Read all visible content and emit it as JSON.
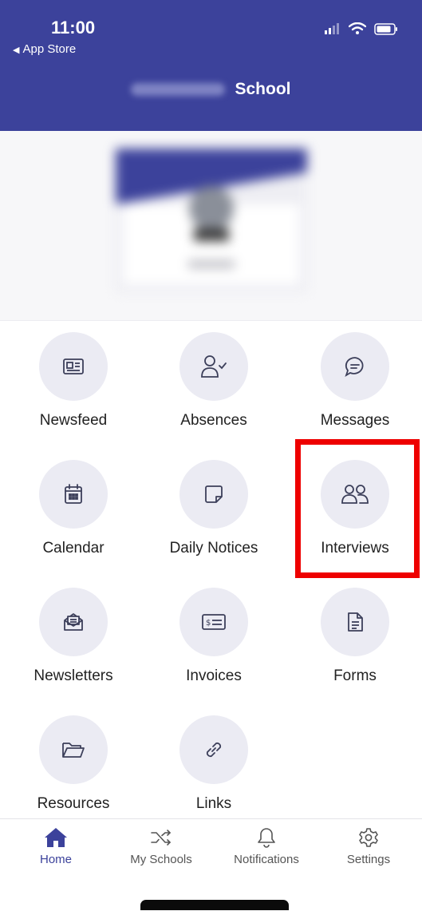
{
  "status_bar": {
    "time": "11:00",
    "back_label": "App Store"
  },
  "header": {
    "title": "School"
  },
  "grid": {
    "items": [
      {
        "label": "Newsfeed",
        "icon": "newspaper-icon"
      },
      {
        "label": "Absences",
        "icon": "user-check-icon"
      },
      {
        "label": "Messages",
        "icon": "chat-bubble-icon"
      },
      {
        "label": "Calendar",
        "icon": "calendar-icon"
      },
      {
        "label": "Daily Notices",
        "icon": "sticky-note-icon"
      },
      {
        "label": "Interviews",
        "icon": "users-icon"
      },
      {
        "label": "Newsletters",
        "icon": "envelope-letter-icon"
      },
      {
        "label": "Invoices",
        "icon": "invoice-icon"
      },
      {
        "label": "Forms",
        "icon": "document-icon"
      },
      {
        "label": "Resources",
        "icon": "folder-icon"
      },
      {
        "label": "Links",
        "icon": "link-icon"
      }
    ]
  },
  "tabs": [
    {
      "label": "Home",
      "icon": "home-icon",
      "active": true
    },
    {
      "label": "My Schools",
      "icon": "shuffle-icon"
    },
    {
      "label": "Notifications",
      "icon": "bell-icon"
    },
    {
      "label": "Settings",
      "icon": "gear-icon"
    }
  ],
  "colors": {
    "header": "#3c429b",
    "accent": "#3c429b",
    "icon_bg": "#ebebf3",
    "highlight": "#ee0000"
  }
}
